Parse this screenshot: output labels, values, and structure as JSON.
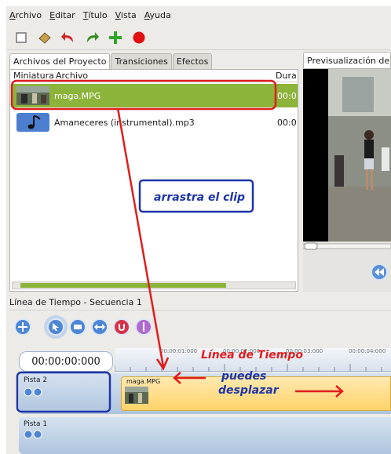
{
  "menu": [
    "Archivo",
    "Editar",
    "Título",
    "Vista",
    "Ayuda"
  ],
  "toolbar_icons": [
    "new-project-icon",
    "open-project-icon",
    "undo-icon",
    "redo-icon",
    "add-clip-icon",
    "record-icon"
  ],
  "project_tabs": [
    "Archivos del Proyecto",
    "Transiciones",
    "Efectos"
  ],
  "columns": {
    "thumb": "Miniatura",
    "file": "Archivo",
    "duration": "Dura"
  },
  "files": [
    {
      "name": "maga.MPG",
      "duration": "00:0"
    },
    {
      "name": "Amaneceres (instrumental).mp3",
      "duration": "00:0"
    }
  ],
  "preview_tab": "Previsualización de v",
  "timeline_title": "Línea de Tiempo - Secuencia 1",
  "timecode": "00:00:00:000",
  "ruler_ticks": [
    "00:00:01:000",
    "00:00:02:000",
    "00:00:03:000",
    "00:00:04:000"
  ],
  "tracks": [
    {
      "label": "Pista 2"
    },
    {
      "label": "Pista 1"
    }
  ],
  "clip_name": "maga.MPG",
  "annotations": {
    "drag": "arrastra el clip",
    "timeline": "Línea de Tiempo",
    "move_1": "puedes",
    "move_2": "desplazar"
  },
  "colors": {
    "selection": "#8cb43a",
    "annotation_red": "#e01e1e",
    "annotation_blue": "#1e35a8"
  }
}
